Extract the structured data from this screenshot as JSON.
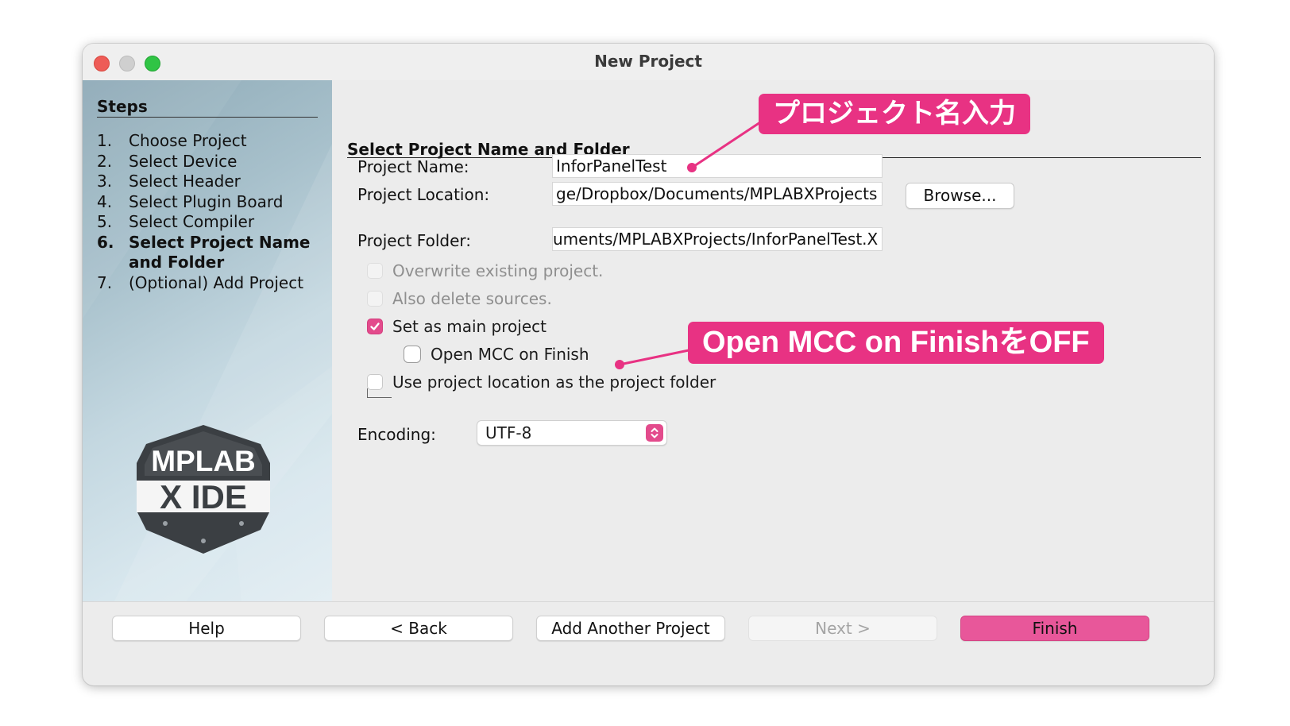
{
  "window": {
    "title": "New Project"
  },
  "sidebar": {
    "steps_title": "Steps",
    "steps": [
      {
        "num": "1.",
        "label": "Choose Project"
      },
      {
        "num": "2.",
        "label": "Select Device"
      },
      {
        "num": "3.",
        "label": "Select Header"
      },
      {
        "num": "4.",
        "label": "Select Plugin Board"
      },
      {
        "num": "5.",
        "label": "Select Compiler"
      },
      {
        "num": "6.",
        "label": "Select Project Name",
        "label2": "and Folder",
        "active": true
      },
      {
        "num": "7.",
        "label": "(Optional) Add Project"
      }
    ],
    "logo": {
      "line1": "MPLAB",
      "line2": "X IDE",
      "icon": "mplab-x-ide-logo"
    }
  },
  "main": {
    "section_title": "Select Project Name and Folder",
    "project_name": {
      "label": "Project Name:",
      "value": "InforPanelTest"
    },
    "project_location": {
      "label": "Project Location:",
      "value": "ge/Dropbox/Documents/MPLABXProjects",
      "browse_label": "Browse..."
    },
    "project_folder": {
      "label": "Project Folder:",
      "value": "uments/MPLABXProjects/InforPanelTest.X"
    },
    "options": {
      "overwrite": {
        "label": "Overwrite existing project.",
        "checked": false,
        "enabled": false
      },
      "delete_sources": {
        "label": "Also delete sources.",
        "checked": false,
        "enabled": false
      },
      "set_main": {
        "label": "Set as main project",
        "checked": true,
        "enabled": true
      },
      "open_mcc": {
        "label": "Open MCC on Finish",
        "checked": false,
        "enabled": true
      },
      "use_location": {
        "label": "Use project location as the project folder",
        "checked": false,
        "enabled": true
      }
    },
    "encoding": {
      "label": "Encoding:",
      "value": "UTF-8"
    }
  },
  "footer": {
    "help": "Help",
    "back": "< Back",
    "add_another": "Add Another Project",
    "next": "Next >",
    "finish": "Finish"
  },
  "annotations": {
    "callout1": "プロジェクト名入力",
    "callout2": "Open MCC on FinishをOFF",
    "color": "#e83283"
  },
  "colors": {
    "accent": "#e34b8c",
    "finish_button": "#e8579a"
  }
}
